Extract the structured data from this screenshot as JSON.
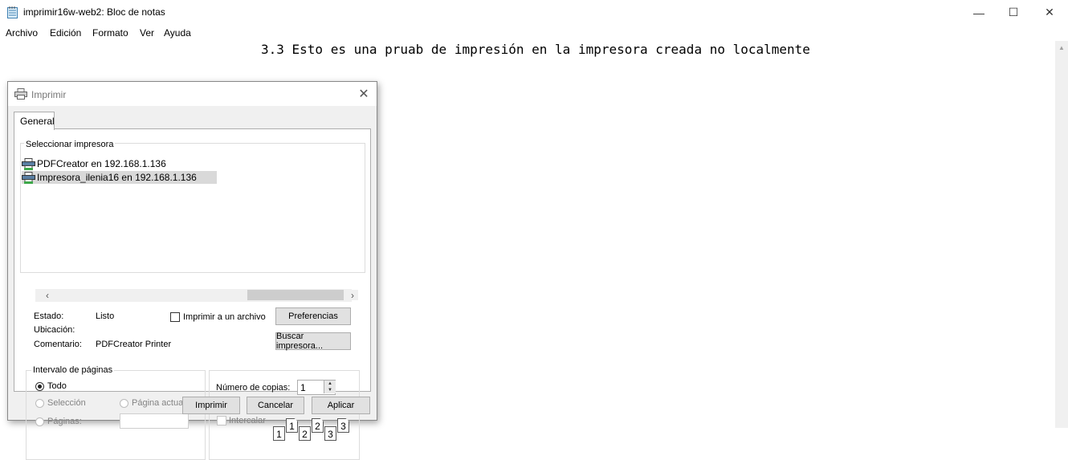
{
  "window": {
    "title": "imprimir16w-web2: Bloc de notas",
    "controls": {
      "minimize": "—",
      "maximize": "☐",
      "close": "✕"
    }
  },
  "menu": [
    "Archivo",
    "Edición",
    "Formato",
    "Ver",
    "Ayuda"
  ],
  "editor": {
    "text": "3.3 Esto es una pruab de impresión en la impresora creada no localmente"
  },
  "dialog": {
    "title": "Imprimir",
    "tab": "General",
    "select_printer": {
      "legend": "Seleccionar impresora",
      "printers": [
        "PDFCreator en 192.168.1.136",
        "Impresora_ilenia16 en 192.168.1.136"
      ],
      "selected_index": 1,
      "status_label": "Estado:",
      "status_value": "Listo",
      "location_label": "Ubicación:",
      "location_value": "",
      "comment_label": "Comentario:",
      "comment_value": "PDFCreator Printer",
      "print_to_file_label": "Imprimir a un archivo",
      "print_to_file_checked": false,
      "preferences_button": "Preferencias",
      "find_printer_button": "Buscar impresora..."
    },
    "page_range": {
      "legend": "Intervalo de páginas",
      "all": "Todo",
      "selection": "Selección",
      "current_page": "Página actual",
      "pages": "Páginas:",
      "selected": "all"
    },
    "copies": {
      "label": "Número de copias:",
      "value": "1",
      "collate_label": "Intercalar",
      "collate_checked": false,
      "collate_pages": [
        "1",
        "1",
        "2",
        "2",
        "3",
        "3"
      ]
    },
    "buttons": {
      "print": "Imprimir",
      "cancel": "Cancelar",
      "apply": "Aplicar"
    }
  },
  "icons": {
    "app": "notepad-icon",
    "dialog": "printer-icon",
    "printer_item": "network-printer-icon"
  }
}
